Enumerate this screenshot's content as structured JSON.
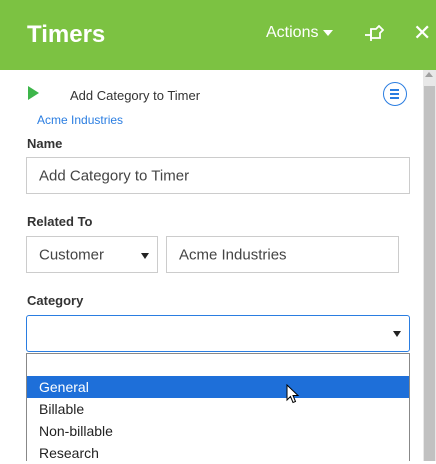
{
  "header": {
    "title": "Timers",
    "actions_label": "Actions",
    "colors": {
      "header_bg": "#7cc242",
      "link": "#2a7de1",
      "selected": "#1e6fd9"
    }
  },
  "timer": {
    "title": "Add Category to Timer",
    "customer_link": "Acme Industries"
  },
  "form": {
    "name_label": "Name",
    "name_value": "Add Category to Timer",
    "related_label": "Related To",
    "related_type": "Customer",
    "related_value": "Acme Industries",
    "category_label": "Category",
    "category_value": ""
  },
  "category_options": [
    "",
    "General",
    "Billable",
    "Non-billable",
    "Research"
  ],
  "selected_option": "General"
}
